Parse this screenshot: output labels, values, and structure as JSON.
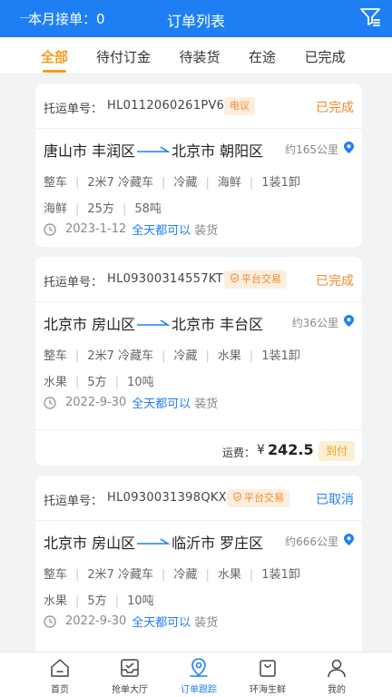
{
  "header": {
    "month_label": "本月接单：0",
    "title": "订单列表",
    "filter_icon": "filter-list-icon"
  },
  "tabs": [
    {
      "label": "全部",
      "active": true
    },
    {
      "label": "待付订金",
      "active": false
    },
    {
      "label": "待装货",
      "active": false
    },
    {
      "label": "在途",
      "active": false
    },
    {
      "label": "已完成",
      "active": false
    }
  ],
  "orders": [
    {
      "ship_label": "托运单号：",
      "ship_no": "HL0112060261PV6",
      "badge": "电议",
      "status": "已完成",
      "origin": "唐山市 丰润区",
      "dest": "北京市 朝阳区",
      "distance": "约165公里",
      "specs1": [
        "整车",
        "2米7 冷藏车",
        "冷藏",
        "海鲜",
        "1装1卸"
      ],
      "specs2": [
        "海鲜",
        "25方",
        "58吨"
      ],
      "date": "2023-1-12",
      "time_note": "全天都可以",
      "load_note": "装货"
    },
    {
      "ship_label": "托运单号：",
      "ship_no": "HL09300314557KT",
      "badge": "平台交易",
      "status": "已完成",
      "origin": "北京市 房山区",
      "dest": "北京市 丰台区",
      "distance": "约36公里",
      "specs1": [
        "整车",
        "2米7 冷藏车",
        "冷藏",
        "水果",
        "1装1卸"
      ],
      "specs2": [
        "水果",
        "5方",
        "10吨"
      ],
      "date": "2022-9-30",
      "time_note": "全天都可以",
      "load_note": "装货",
      "fee_label": "运费：",
      "fee_currency": "¥",
      "fee_value": "242.5",
      "pay_badge": "到付"
    },
    {
      "ship_label": "托运单号：",
      "ship_no": "HL0930031398QKX",
      "badge": "平台交易",
      "status": "已取消",
      "origin": "北京市 房山区",
      "dest": "临沂市 罗庄区",
      "distance": "约666公里",
      "specs1": [
        "整车",
        "2米7 冷藏车",
        "冷藏",
        "水果",
        "1装1卸"
      ],
      "specs2": [
        "水果",
        "5方",
        "10吨"
      ],
      "date": "2022-9-30",
      "time_note": "全天都可以",
      "load_note": "装货"
    }
  ],
  "bottom_nav": [
    {
      "label": "首页",
      "icon": "home-icon",
      "active": false
    },
    {
      "label": "抢单大厅",
      "icon": "inbox-icon",
      "active": false
    },
    {
      "label": "订单跟踪",
      "icon": "map-pin-icon",
      "active": true
    },
    {
      "label": "环海生鲜",
      "icon": "bag-icon",
      "active": false
    },
    {
      "label": "我的",
      "icon": "user-icon",
      "active": false
    }
  ],
  "colors": {
    "primary": "#1e7ff5",
    "accent": "#f0a020",
    "done": "#f08a2a",
    "background": "#f2f3f5"
  }
}
